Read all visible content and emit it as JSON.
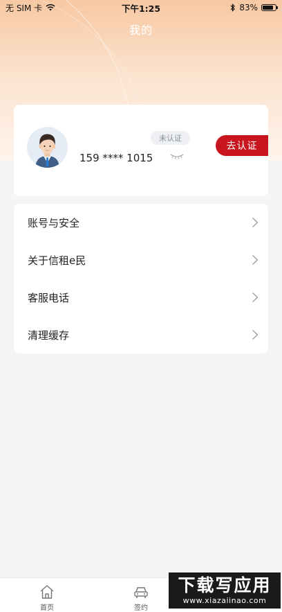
{
  "status_bar": {
    "carrier": "无 SIM 卡",
    "time": "下午1:25",
    "battery": "83%",
    "battery_level": 0.83
  },
  "header": {
    "title": "我的"
  },
  "profile": {
    "phone": "159 **** 1015",
    "verify_status": "未认证",
    "verify_button": "去认证"
  },
  "menu": {
    "items": [
      {
        "label": "账号与安全"
      },
      {
        "label": "关于信租e民"
      },
      {
        "label": "客服电话"
      },
      {
        "label": "清理缓存"
      }
    ]
  },
  "tabs": [
    {
      "label": "首页",
      "icon": "home-icon"
    },
    {
      "label": "签约",
      "icon": "car-icon"
    }
  ],
  "watermark": {
    "title": "下载写应用",
    "url": "www.xiazaiinao.com"
  },
  "colors": {
    "accent": "#c9151e",
    "hero_top": "#f7c8a3",
    "background": "#f5f5f7"
  }
}
